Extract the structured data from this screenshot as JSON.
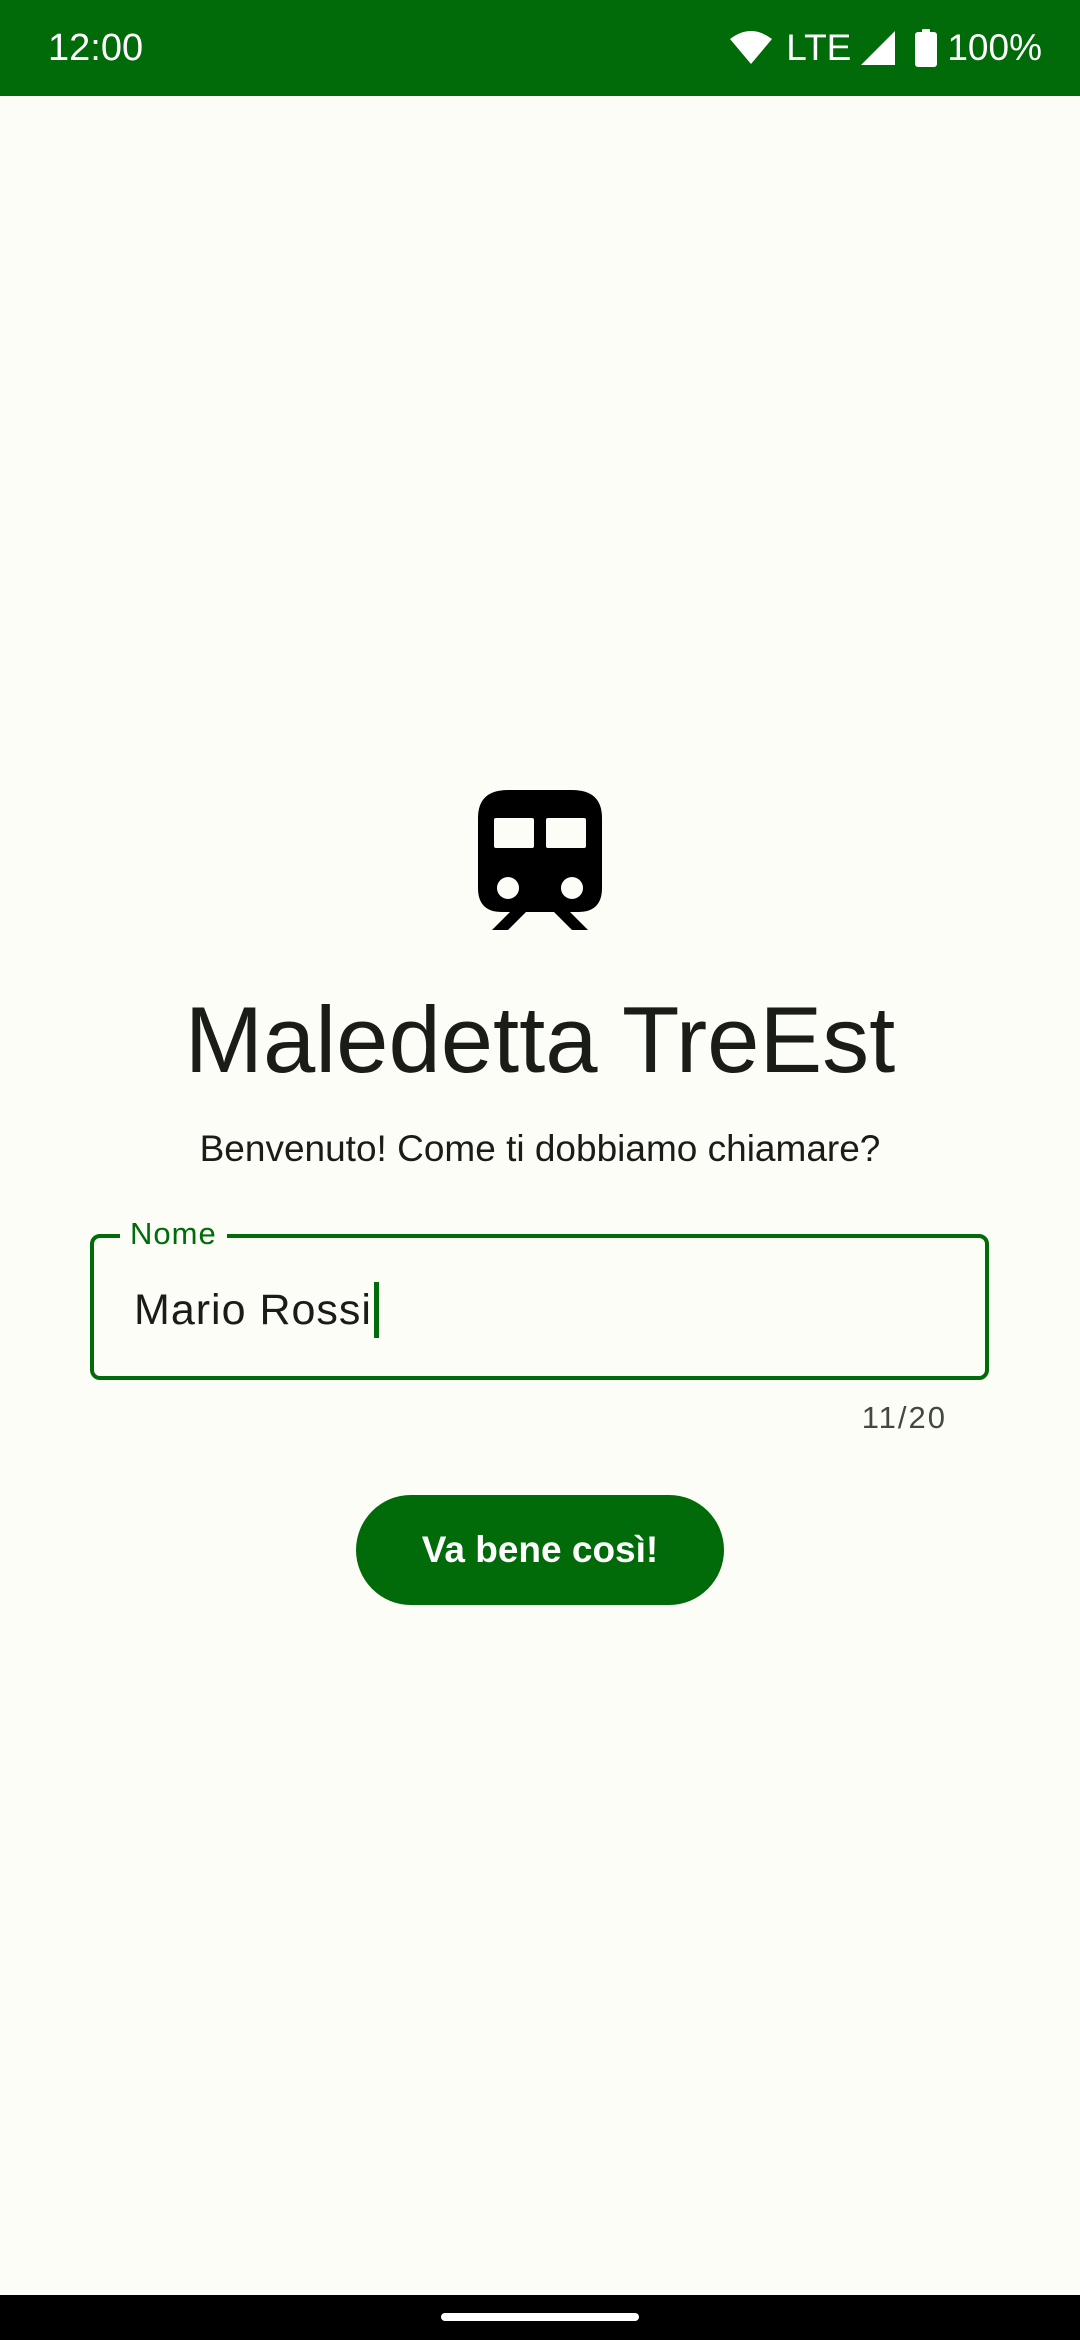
{
  "status_bar": {
    "time": "12:00",
    "network": "LTE",
    "battery": "100%",
    "icons": [
      "wifi-icon",
      "signal-icon",
      "battery-icon"
    ]
  },
  "app": {
    "icon": "train-icon",
    "title": "Maledetta TreEst",
    "subtitle": "Benvenuto! Come ti dobbiamo chiamare?"
  },
  "name_field": {
    "label": "Nome",
    "value": "Mario Rossi",
    "counter": "11/20"
  },
  "actions": {
    "confirm_label": "Va bene così!"
  },
  "colors": {
    "primary": "#006b08",
    "background": "#fcfdf7",
    "text": "#1a1c18"
  }
}
